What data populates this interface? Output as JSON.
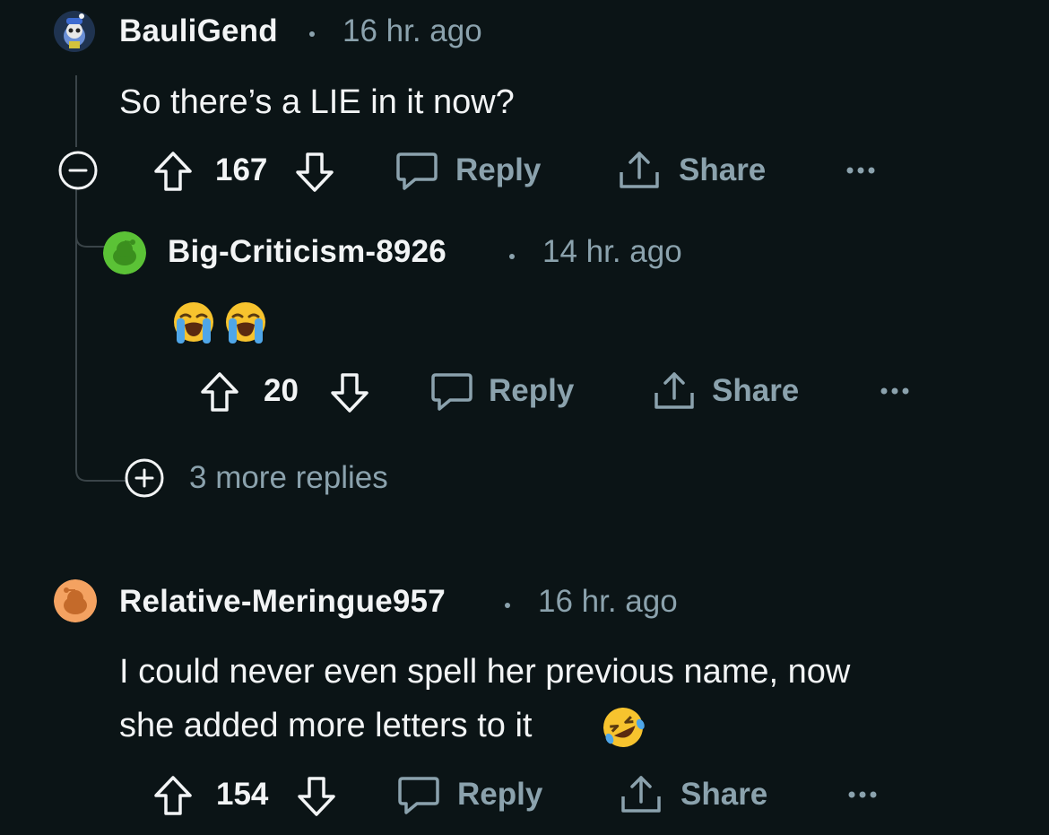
{
  "colors": {
    "background": "#0b1416",
    "text_primary": "#f2f4f5",
    "text_secondary": "#8ba2ad",
    "thread_line": "#3a4448"
  },
  "comments": [
    {
      "username": "BauliGend",
      "separator": "•",
      "timestamp": "16 hr. ago",
      "body": "So there’s a LIE in it now?",
      "votes": "167",
      "reply_label": "Reply",
      "share_label": "Share",
      "avatar_icon": "snoo-avatar-icon",
      "collapse_icon": "collapse-minus-icon"
    },
    {
      "username": "Big-Criticism-8926",
      "separator": "•",
      "timestamp": "14 hr. ago",
      "body_emoji": "loudly-crying-face-icon loudly-crying-face-icon",
      "votes": "20",
      "reply_label": "Reply",
      "share_label": "Share",
      "avatar_icon": "green-snoo-avatar-icon"
    },
    {
      "username": "Relative-Meringue957",
      "separator": "•",
      "timestamp": "16 hr. ago",
      "body_line1": "I could never even spell her previous name, now",
      "body_line2": "she added more letters to it",
      "body_emoji": "rolling-on-floor-laughing-icon",
      "votes": "154",
      "reply_label": "Reply",
      "share_label": "Share",
      "avatar_icon": "orange-snoo-avatar-icon"
    }
  ],
  "more_replies": {
    "label": "3 more replies",
    "icon": "expand-plus-icon"
  }
}
